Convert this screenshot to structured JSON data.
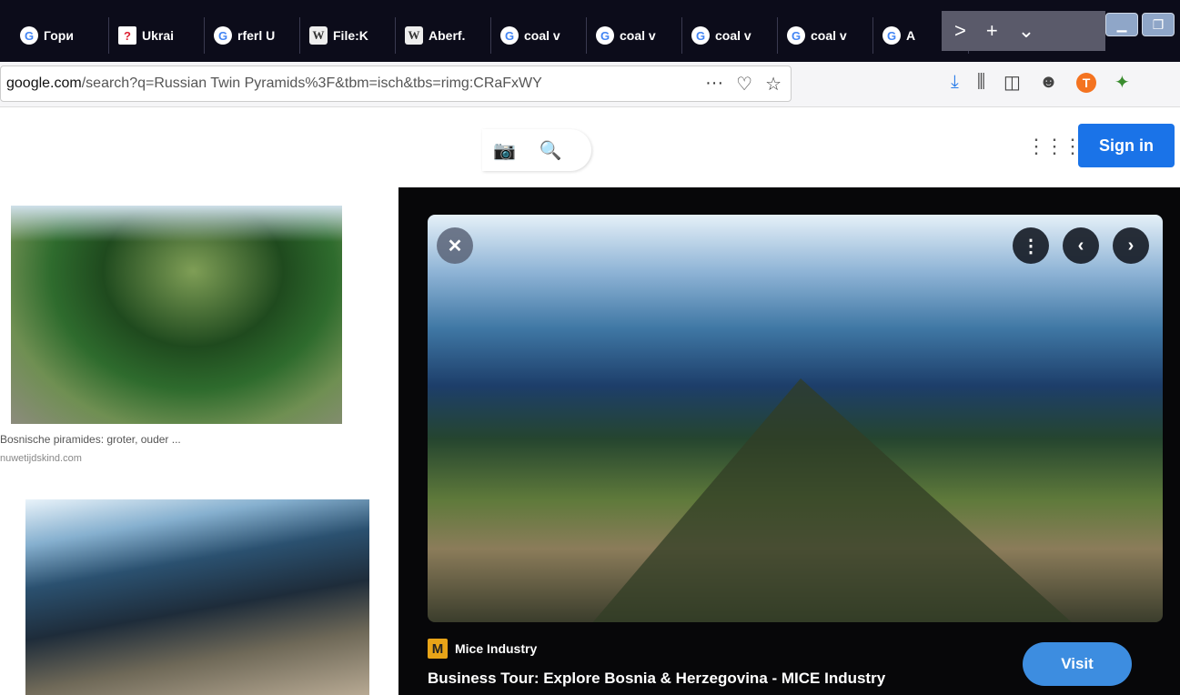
{
  "tabs": [
    {
      "icon": "G",
      "kind": "g",
      "label": "Гори"
    },
    {
      "icon": "?",
      "kind": "u",
      "label": "Ukrai"
    },
    {
      "icon": "G",
      "kind": "g",
      "label": "rferl U"
    },
    {
      "icon": "W",
      "kind": "w",
      "label": "File:K"
    },
    {
      "icon": "W",
      "kind": "w",
      "label": "Aberf."
    },
    {
      "icon": "G",
      "kind": "g",
      "label": "coal v"
    },
    {
      "icon": "G",
      "kind": "g",
      "label": "coal v"
    },
    {
      "icon": "G",
      "kind": "g",
      "label": "coal v"
    },
    {
      "icon": "G",
      "kind": "g",
      "label": "coal v"
    },
    {
      "icon": "G",
      "kind": "g",
      "label": "A"
    }
  ],
  "tabctrl": {
    "next": ">",
    "new": "+",
    "list": "⌄"
  },
  "address": {
    "domain": "google.com",
    "path": "/search?q=Russian Twin Pyramids%3F&tbm=isch&tbs=rimg:CRaFxWY"
  },
  "url_actions": {
    "more": "···",
    "pocket": "♡",
    "star": "☆"
  },
  "toolbar": {
    "download": "⤓",
    "library": "⫼",
    "sidebar": "◫",
    "account": "☻",
    "ublock": "T",
    "ext": "✦"
  },
  "header": {
    "camera": "📷",
    "search": "🔍",
    "apps": "⋮⋮⋮",
    "signin": "Sign in"
  },
  "results": {
    "caption": "Bosnische piramides: groter, ouder ...",
    "source": "nuwetijdskind.com"
  },
  "panel": {
    "source_name": "Mice Industry",
    "source_logo": "M",
    "title": "Business Tour: Explore Bosnia & Herzegovina - MICE Industry",
    "visit": "Visit",
    "close": "✕",
    "more": "⋮",
    "prev": "‹",
    "next": "›"
  }
}
